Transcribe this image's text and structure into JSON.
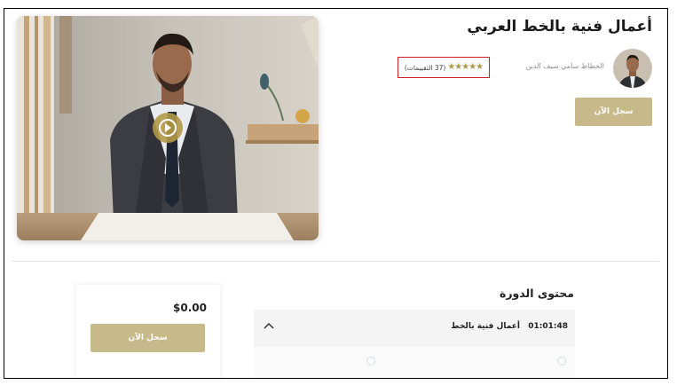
{
  "course": {
    "title": "أعمال فنية بالخط العربي",
    "instructor": "الخطاط سامي سيف الدين",
    "rating_stars": 5,
    "reviews_text": "(37 التقييمات)",
    "enroll_label": "سجل الآن"
  },
  "pricing": {
    "price": "$0.00",
    "enroll_label": "سجل الآن"
  },
  "content": {
    "section_title": "محتوى الدورة",
    "first_item": {
      "duration": "01:01:48",
      "name": "أعمال فنية بالخط"
    }
  },
  "colors": {
    "accent": "#c8b98a",
    "star": "#b39a48",
    "highlight_border": "#d01f25"
  }
}
